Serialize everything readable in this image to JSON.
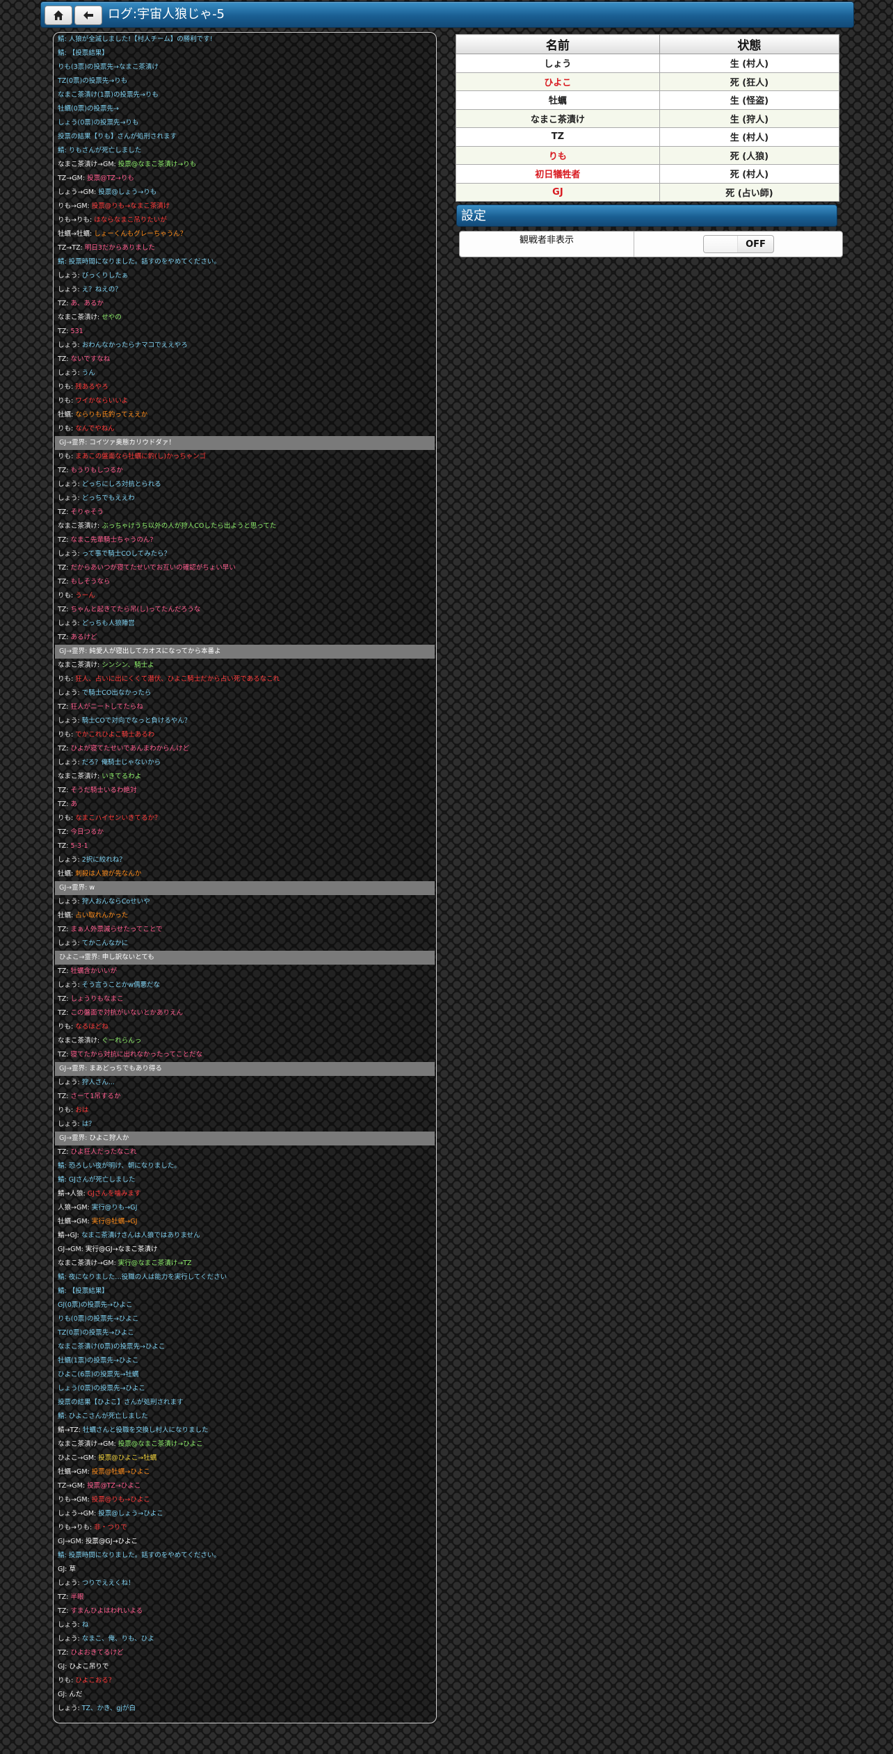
{
  "header": {
    "title": "ログ:宇宙人狼じゃ-5"
  },
  "status_table": {
    "headers": [
      "名前",
      "状態"
    ],
    "rows": [
      {
        "name": "しょう",
        "state": "生 (村人)",
        "dead": false
      },
      {
        "name": "ひよこ",
        "state": "死 (狂人)",
        "dead": true
      },
      {
        "name": "牡蠣",
        "state": "生 (怪盗)",
        "dead": false
      },
      {
        "name": "なまこ茶漬け",
        "state": "生 (狩人)",
        "dead": false
      },
      {
        "name": "TZ",
        "state": "生 (村人)",
        "dead": false
      },
      {
        "name": "りも",
        "state": "死 (人狼)",
        "dead": true
      },
      {
        "name": "初日犠牲者",
        "state": "死 (村人)",
        "dead": true
      },
      {
        "name": "GJ",
        "state": "死 (占い師)",
        "dead": true
      }
    ]
  },
  "settings": {
    "title": "設定",
    "spectator_label": "観戦者非表示",
    "toggle_value": "OFF"
  },
  "colors": {
    "header_blue": "#1a5f93",
    "dead_red": "#d8191f"
  },
  "icons": {
    "home": "home-icon",
    "back": "arrow-left-icon"
  },
  "chat": [
    {
      "s": "",
      "t": "鯖: 人狼が全滅しました!【村人チーム】の勝利です!",
      "c": "c-cyan"
    },
    {
      "s": "",
      "t": "鯖: 【投票結果】",
      "c": "c-cyan"
    },
    {
      "s": "",
      "t": "りも(3票)の投票先→なまこ茶漬け",
      "c": "c-cyan"
    },
    {
      "s": "",
      "t": "TZ(0票)の投票先→りも",
      "c": "c-cyan"
    },
    {
      "s": "",
      "t": "なまこ茶漬け(1票)の投票先→りも",
      "c": "c-cyan"
    },
    {
      "s": "",
      "t": "牡蠣(0票)の投票先→",
      "c": "c-cyan"
    },
    {
      "s": "",
      "t": "しょう(0票)の投票先→りも",
      "c": "c-cyan"
    },
    {
      "s": "",
      "t": "投票の結果【りも】さんが処刑されます",
      "c": "c-cyan"
    },
    {
      "s": "",
      "t": "鯖: りもさんが死亡しました",
      "c": "c-cyan"
    },
    {
      "s": "なまこ茶漬け→GM: ",
      "t": "投票@なまこ茶漬け→りも",
      "c": "c-green"
    },
    {
      "s": "TZ→GM: ",
      "t": "投票@TZ→りも",
      "c": "c-pink"
    },
    {
      "s": "しょう→GM: ",
      "t": "投票@しょう→りも",
      "c": "c-cyan"
    },
    {
      "s": "りも→GM: ",
      "t": "投票@りも→なまこ茶漬け",
      "c": "c-red"
    },
    {
      "s": "りも→りも: ",
      "t": "ほならなまこ吊りたいが",
      "c": "c-red"
    },
    {
      "s": "牡蠣→牡蠣: ",
      "t": "しょーくんもグレーちゃうん？",
      "c": "c-orange"
    },
    {
      "s": "TZ→TZ: ",
      "t": "明日3だからありました",
      "c": "c-pink"
    },
    {
      "s": "",
      "t": "鯖: 投票時間になりました。話すのをやめてください。",
      "c": "c-cyan"
    },
    {
      "s": "しょう: ",
      "t": "びっくりしたぁ",
      "c": "c-cyan"
    },
    {
      "s": "しょう: ",
      "t": "え？ねえの？",
      "c": "c-cyan"
    },
    {
      "s": "TZ: ",
      "t": "あ、あるか",
      "c": "c-pink"
    },
    {
      "s": "なまこ茶漬け: ",
      "t": "せやの",
      "c": "c-green"
    },
    {
      "s": "TZ: ",
      "t": "531",
      "c": "c-pink"
    },
    {
      "s": "しょう: ",
      "t": "おわんなかったらナマコでええやろ",
      "c": "c-cyan"
    },
    {
      "s": "TZ: ",
      "t": "ないですなね",
      "c": "c-pink"
    },
    {
      "s": "しょう: ",
      "t": "うん",
      "c": "c-cyan"
    },
    {
      "s": "りも: ",
      "t": "残あるやろ",
      "c": "c-red"
    },
    {
      "s": "りも: ",
      "t": "ワイかならいいよ",
      "c": "c-red"
    },
    {
      "s": "牡蠣: ",
      "t": "ならりも氏釣ってええか",
      "c": "c-orange"
    },
    {
      "s": "りも: ",
      "t": "なんでやねん",
      "c": "c-red"
    },
    {
      "s": "GJ→霊界: ",
      "t": "コイツァ奥態カリウドダァ！",
      "c": "c-white",
      "hl": true
    },
    {
      "s": "りも: ",
      "t": "まあこの盤面なら牡蠣に釣(し)かっちゃンゴ",
      "c": "c-red"
    },
    {
      "s": "TZ: ",
      "t": "もうりもしつるか",
      "c": "c-pink"
    },
    {
      "s": "しょう: ",
      "t": "どっちにしろ対抗とられる",
      "c": "c-cyan"
    },
    {
      "s": "しょう: ",
      "t": "どっちでもええわ",
      "c": "c-cyan"
    },
    {
      "s": "TZ: ",
      "t": "そりゃそう",
      "c": "c-pink"
    },
    {
      "s": "なまこ茶漬け: ",
      "t": "ぶっちゃけうち以外の人が狩人COしたら出ようと思ってた",
      "c": "c-green"
    },
    {
      "s": "TZ: ",
      "t": "なまこ先輩騎士ちゃうのん?",
      "c": "c-pink"
    },
    {
      "s": "しょう: ",
      "t": "って事で騎士COしてみたら？",
      "c": "c-cyan"
    },
    {
      "s": "TZ: ",
      "t": "だからあいつが寝てたせいでお互いの確認がちょい早い",
      "c": "c-pink"
    },
    {
      "s": "TZ: ",
      "t": "もしそうなら",
      "c": "c-pink"
    },
    {
      "s": "りも: ",
      "t": "うーん",
      "c": "c-red"
    },
    {
      "s": "TZ: ",
      "t": "ちゃんと起きてたら吊(し)ってたんだろうな",
      "c": "c-pink"
    },
    {
      "s": "しょう: ",
      "t": "どっちも人狼陣営",
      "c": "c-cyan"
    },
    {
      "s": "TZ: ",
      "t": "あるけど",
      "c": "c-pink"
    },
    {
      "s": "GJ→霊界: ",
      "t": "純愛人が寝出してカオスになってから本番よ",
      "c": "c-white",
      "hl": true
    },
    {
      "s": "なまこ茶漬け: ",
      "t": "シンシン、騎士よ",
      "c": "c-green"
    },
    {
      "s": "りも: ",
      "t": "狂人、占いに出にくくて潜伏、ひよこ騎士だから占い死であるなこれ",
      "c": "c-red"
    },
    {
      "s": "しょう: ",
      "t": "で騎士CO出なかったら",
      "c": "c-cyan"
    },
    {
      "s": "TZ: ",
      "t": "狂人がニートしてたらね",
      "c": "c-pink"
    },
    {
      "s": "しょう: ",
      "t": "騎士COで対向でなっと負けるやん？",
      "c": "c-cyan"
    },
    {
      "s": "りも: ",
      "t": "でかこれひよこ騎士あるわ",
      "c": "c-red"
    },
    {
      "s": "TZ: ",
      "t": "ひよが寝てたせいであんまわからんけど",
      "c": "c-pink"
    },
    {
      "s": "しょう: ",
      "t": "だろ？俺騎士じゃないから",
      "c": "c-cyan"
    },
    {
      "s": "なまこ茶漬け: ",
      "t": "いきてるわよ",
      "c": "c-green"
    },
    {
      "s": "TZ: ",
      "t": "そうだ騎士いるわ絶対",
      "c": "c-pink"
    },
    {
      "s": "TZ: ",
      "t": "あ",
      "c": "c-pink"
    },
    {
      "s": "りも: ",
      "t": "なまこハイセンいきてるか？",
      "c": "c-red"
    },
    {
      "s": "TZ: ",
      "t": "今日つるか",
      "c": "c-pink"
    },
    {
      "s": "TZ: ",
      "t": "5-3-1",
      "c": "c-pink"
    },
    {
      "s": "しょう: ",
      "t": "2択に絞れね？",
      "c": "c-cyan"
    },
    {
      "s": "牡蠣: ",
      "t": "刺殺は人狼が先なんか",
      "c": "c-orange"
    },
    {
      "s": "GJ→霊界: ",
      "t": "w",
      "c": "c-white",
      "hl": true
    },
    {
      "s": "しょう: ",
      "t": "狩人おんならCoせいや",
      "c": "c-cyan"
    },
    {
      "s": "牡蠣: ",
      "t": "占い取れんかった",
      "c": "c-orange"
    },
    {
      "s": "TZ: ",
      "t": "まぁ人外票減らせたってことで",
      "c": "c-pink"
    },
    {
      "s": "しょう: ",
      "t": "てかこんなかに",
      "c": "c-cyan"
    },
    {
      "s": "ひよこ→霊界: ",
      "t": "申し訳ないとても",
      "c": "c-white",
      "hl": true
    },
    {
      "s": "TZ: ",
      "t": "牡蠣含かいいが",
      "c": "c-pink"
    },
    {
      "s": "しょう: ",
      "t": "そう言うことかw偶悪だな",
      "c": "c-cyan"
    },
    {
      "s": "TZ: ",
      "t": "しょうりもなまこ",
      "c": "c-pink"
    },
    {
      "s": "TZ: ",
      "t": "この盤面で対抗がいないとかありえん",
      "c": "c-pink"
    },
    {
      "s": "りも: ",
      "t": "なるほどね",
      "c": "c-red"
    },
    {
      "s": "なまこ茶漬け: ",
      "t": "ぐーれらんっ",
      "c": "c-green"
    },
    {
      "s": "TZ: ",
      "t": "寝てたから対抗に出れなかったってことだな",
      "c": "c-pink"
    },
    {
      "s": "GJ→霊界: ",
      "t": "まあどっちでもあり得る",
      "c": "c-white",
      "hl": true
    },
    {
      "s": "しょう: ",
      "t": "狩人さん...",
      "c": "c-cyan"
    },
    {
      "s": "TZ: ",
      "t": "さーて1吊するか",
      "c": "c-pink"
    },
    {
      "s": "りも: ",
      "t": "おは",
      "c": "c-red"
    },
    {
      "s": "しょう: ",
      "t": "は？",
      "c": "c-cyan"
    },
    {
      "s": "GJ→霊界: ",
      "t": "ひよこ狩人か",
      "c": "c-white",
      "hl": true
    },
    {
      "s": "TZ: ",
      "t": "ひよ狂人だったなこれ",
      "c": "c-pink"
    },
    {
      "s": "",
      "t": "鯖: 恐ろしい夜が明け、朝になりました。",
      "c": "c-cyan"
    },
    {
      "s": "",
      "t": "鯖: GJさんが死亡しました",
      "c": "c-cyan"
    },
    {
      "s": "鯖→人狼: ",
      "t": "GJさんを噛みます",
      "c": "c-red"
    },
    {
      "s": "人狼→GM: ",
      "t": "実行@りも→GJ",
      "c": "c-cyan"
    },
    {
      "s": "牡蠣→GM: ",
      "t": "実行@牡蠣→GJ",
      "c": "c-orange"
    },
    {
      "s": "鯖→GJ: ",
      "t": "なまこ茶漬けさんは人狼ではありません",
      "c": "c-cyan"
    },
    {
      "s": "GJ→GM: ",
      "t": "実行@GJ→なまこ茶漬け",
      "c": "c-white"
    },
    {
      "s": "なまこ茶漬け→GM: ",
      "t": "実行@なまこ茶漬け→TZ",
      "c": "c-green"
    },
    {
      "s": "",
      "t": "鯖: 夜になりました…役職の人は能力を実行してください",
      "c": "c-cyan"
    },
    {
      "s": "",
      "t": "鯖: 【投票結果】",
      "c": "c-cyan"
    },
    {
      "s": "",
      "t": "GJ(0票)の投票先→ひよこ",
      "c": "c-cyan"
    },
    {
      "s": "",
      "t": "りも(0票)の投票先→ひよこ",
      "c": "c-cyan"
    },
    {
      "s": "",
      "t": "TZ(0票)の投票先→ひよこ",
      "c": "c-cyan"
    },
    {
      "s": "",
      "t": "なまこ茶漬け(0票)の投票先→ひよこ",
      "c": "c-cyan"
    },
    {
      "s": "",
      "t": "牡蠣(1票)の投票先→ひよこ",
      "c": "c-cyan"
    },
    {
      "s": "",
      "t": "ひよこ(6票)の投票先→牡蠣",
      "c": "c-cyan"
    },
    {
      "s": "",
      "t": "しょう(0票)の投票先→ひよこ",
      "c": "c-cyan"
    },
    {
      "s": "",
      "t": "投票の結果【ひよこ】さんが処刑されます",
      "c": "c-cyan"
    },
    {
      "s": "",
      "t": "鯖: ひよこさんが死亡しました",
      "c": "c-cyan"
    },
    {
      "s": "鯖→TZ: ",
      "t": "牡蠣さんと役職を交換し村人になりました",
      "c": "c-cyan"
    },
    {
      "s": "なまこ茶漬け→GM: ",
      "t": "投票@なまこ茶漬け→ひよこ",
      "c": "c-green"
    },
    {
      "s": "ひよこ→GM: ",
      "t": "投票@ひよこ→牡蠣",
      "c": "c-yellow"
    },
    {
      "s": "牡蠣→GM: ",
      "t": "投票@牡蠣→ひよこ",
      "c": "c-orange"
    },
    {
      "s": "TZ→GM: ",
      "t": "投票@TZ→ひよこ",
      "c": "c-pink"
    },
    {
      "s": "りも→GM: ",
      "t": "投票@りも→ひよこ",
      "c": "c-red"
    },
    {
      "s": "しょう→GM: ",
      "t": "投票@しょう→ひよこ",
      "c": "c-cyan"
    },
    {
      "s": "りも→りも: ",
      "t": "非・つりで",
      "c": "c-red"
    },
    {
      "s": "GJ→GM: ",
      "t": "投票@GJ→ひよこ",
      "c": "c-white"
    },
    {
      "s": "",
      "t": "鯖: 投票時間になりました。話すのをやめてください。",
      "c": "c-cyan"
    },
    {
      "s": "GJ: ",
      "t": "草",
      "c": "c-white"
    },
    {
      "s": "しょう: ",
      "t": "つりでええくね！",
      "c": "c-cyan"
    },
    {
      "s": "TZ: ",
      "t": "半眼",
      "c": "c-pink"
    },
    {
      "s": "TZ: ",
      "t": "すまんひよはわれいよる",
      "c": "c-pink"
    },
    {
      "s": "しょう: ",
      "t": "ね",
      "c": "c-cyan"
    },
    {
      "s": "しょう: ",
      "t": "なまこ、俺、りも、ひよ",
      "c": "c-cyan"
    },
    {
      "s": "TZ: ",
      "t": "ひよおきてるけど",
      "c": "c-pink"
    },
    {
      "s": "GJ: ",
      "t": "ひよこ吊りで",
      "c": "c-white"
    },
    {
      "s": "りも: ",
      "t": "ひよこおる？",
      "c": "c-red"
    },
    {
      "s": "GJ: ",
      "t": "んだ",
      "c": "c-white"
    },
    {
      "s": "しょう: ",
      "t": "TZ、かき、gjが白",
      "c": "c-cyan"
    }
  ]
}
